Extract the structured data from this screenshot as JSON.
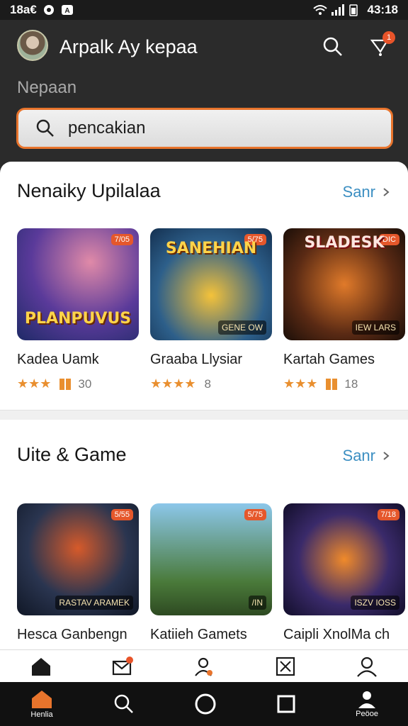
{
  "status_bar": {
    "time": "18a€",
    "clock": "43:18"
  },
  "header": {
    "title": "Arpalk Ay kepaa",
    "subtitle": "Nepaan",
    "search_placeholder": "pencakian",
    "notification_count": "1",
    "accent_color": "#e8742c"
  },
  "sections": [
    {
      "title": "Nenaiky Upilalaa",
      "see_all": "Sanr",
      "cards": [
        {
          "name": "Kadea Uamk",
          "stars": 3,
          "count": "30",
          "thumb_text": "PLANPUVUS",
          "badge": "7/05"
        },
        {
          "name": "Graaba Llysiar",
          "stars": 4,
          "count": "8",
          "thumb_text": "SANEHIAN",
          "badge": "5/75",
          "small": "GENE OW"
        },
        {
          "name": "Kartah Games",
          "stars": 3,
          "count": "18",
          "thumb_text": "SLADESK",
          "badge": "DIC",
          "small": "IEW LARS"
        }
      ]
    },
    {
      "title": "Uite & Game",
      "see_all": "Sanr",
      "cards": [
        {
          "name": "Hesca Ganbengn",
          "thumb_text": "",
          "badge": "5/55",
          "small": "RASTAV ARAMEK"
        },
        {
          "name": "Katiieh Gamets",
          "thumb_text": "",
          "badge": "5/75",
          "small": "/IN"
        },
        {
          "name": "Caipli XnolMa ch",
          "thumb_text": "",
          "badge": "7/18",
          "small": "ISZV IOSS"
        }
      ]
    }
  ],
  "nav": {
    "home_label": "Henlia",
    "profile_label": "Peöoe"
  },
  "icons": [
    "search-icon",
    "heart-cart-icon",
    "home-icon",
    "mail-icon",
    "person-icon",
    "grid-icon",
    "profile-icon"
  ]
}
